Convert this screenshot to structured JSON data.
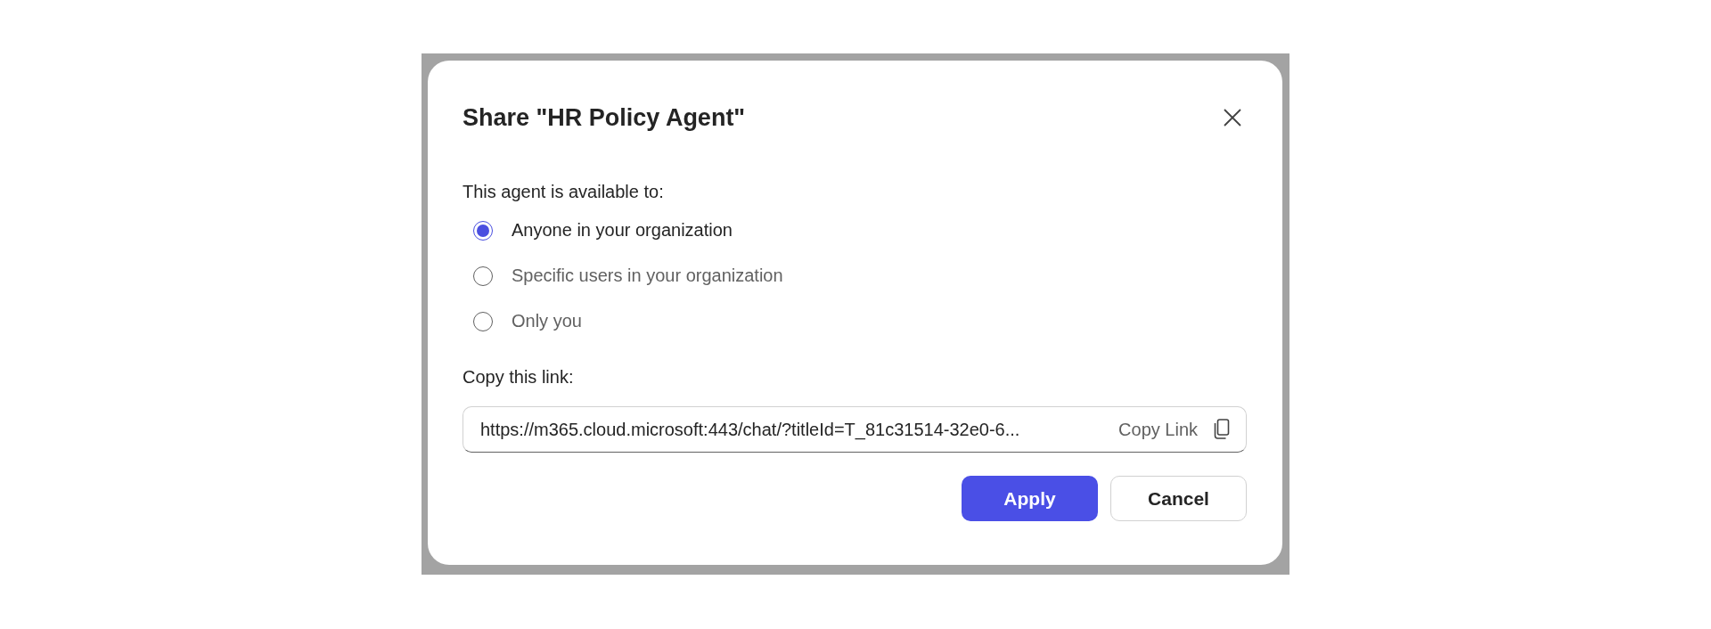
{
  "dialog": {
    "title": "Share \"HR Policy Agent\"",
    "availability_label": "This agent is available to:",
    "options": [
      {
        "label": "Anyone in your organization",
        "selected": true
      },
      {
        "label": "Specific users in your organization",
        "selected": false
      },
      {
        "label": "Only you",
        "selected": false
      }
    ],
    "link_label": "Copy this link:",
    "link": {
      "value": "https://m365.cloud.microsoft:443/chat/?titleId=T_81c31514-32e0-6...",
      "copy_label": "Copy Link"
    },
    "buttons": [
      {
        "label": "Apply",
        "kind": "primary"
      },
      {
        "label": "Cancel",
        "kind": "secondary"
      }
    ]
  }
}
